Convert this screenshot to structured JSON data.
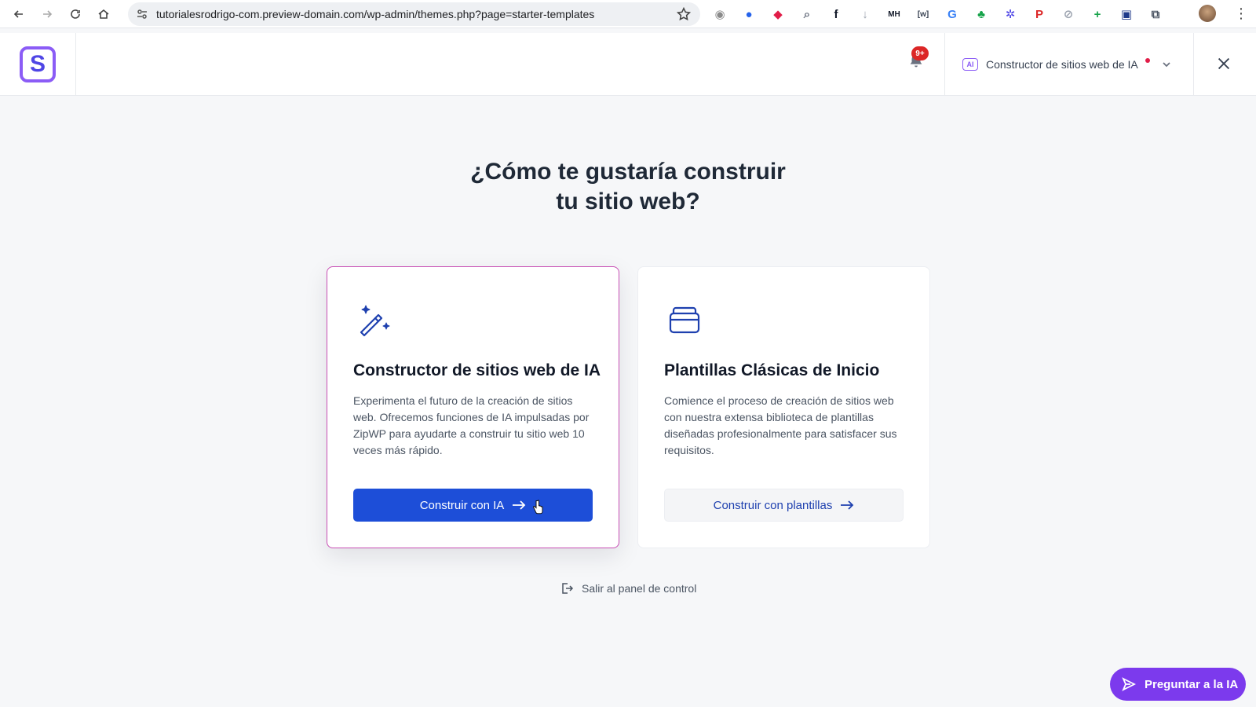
{
  "browser": {
    "url": "tutorialesrodrigo-com.preview-domain.com/wp-admin/themes.php?page=starter-templates",
    "extensions": [
      {
        "name": "camera-extension-icon",
        "color": "#8a8a8a",
        "glyph": "◉"
      },
      {
        "name": "blue-circle-extension-icon",
        "color": "#2563eb",
        "glyph": "●"
      },
      {
        "name": "color-picker-extension-icon",
        "color": "#e11d48",
        "glyph": "◆"
      },
      {
        "name": "magnifier-extension-icon",
        "color": "#6b7280",
        "glyph": "⌕"
      },
      {
        "name": "font-extension-icon",
        "color": "#111827",
        "glyph": "f"
      },
      {
        "name": "download-extension-icon",
        "color": "#9ca3af",
        "glyph": "↓"
      },
      {
        "name": "mh-extension-icon",
        "color": "#111827",
        "glyph": "MH"
      },
      {
        "name": "bracket-w-extension-icon",
        "color": "#374151",
        "glyph": "[w]"
      },
      {
        "name": "translate-extension-icon",
        "color": "#3b82f6",
        "glyph": "G"
      },
      {
        "name": "leaf-extension-icon",
        "color": "#16a34a",
        "glyph": "♣"
      },
      {
        "name": "gear-extension-icon",
        "color": "#4f46e5",
        "glyph": "✲"
      },
      {
        "name": "pinterest-extension-icon",
        "color": "#dc2626",
        "glyph": "P"
      },
      {
        "name": "compass-extension-icon",
        "color": "#9ca3af",
        "glyph": "⊘"
      },
      {
        "name": "plus-extension-icon",
        "color": "#16a34a",
        "glyph": "+"
      },
      {
        "name": "screen-extension-icon",
        "color": "#1e3a8a",
        "glyph": "▣"
      },
      {
        "name": "puzzle-extension-icon",
        "color": "#4b5563",
        "glyph": "⧉"
      }
    ]
  },
  "header": {
    "logo_letter": "S",
    "notification_badge": "9+",
    "mode_chip": "AI",
    "mode_label": "Constructor de sitios web de IA"
  },
  "main": {
    "title_line1": "¿Cómo te gustaría construir",
    "title_line2": "tu sitio web?",
    "cards": [
      {
        "title": "Constructor de sitios web de IA",
        "description": "Experimenta el futuro de la creación de sitios web. Ofrecemos funciones de IA impulsadas por ZipWP para ayudarte a construir tu sitio web 10 veces más rápido.",
        "button_label": "Construir con IA"
      },
      {
        "title": "Plantillas Clásicas de Inicio",
        "description": "Comience el proceso de creación de sitios web con nuestra extensa biblioteca de plantillas diseñadas profesionalmente para satisfacer sus requisitos.",
        "button_label": "Construir con plantillas"
      }
    ],
    "exit_label": "Salir al panel de control"
  },
  "ask_ai_label": "Preguntar a la IA",
  "colors": {
    "primary": "#1d4ed8",
    "accent": "#7c3aed",
    "highlight_border": "#c84fb5"
  }
}
